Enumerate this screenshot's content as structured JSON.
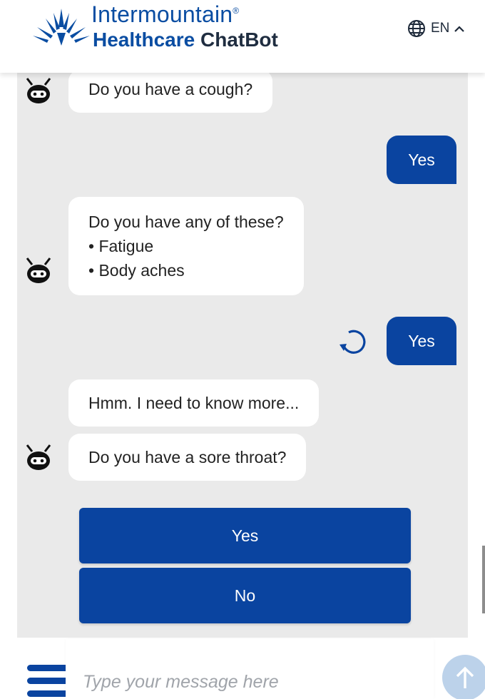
{
  "header": {
    "brand_line1": "Intermountain",
    "brand_reg": "®",
    "brand_healthcare": "Healthcare",
    "brand_chatbot": "ChatBot",
    "language": "EN",
    "accent_color": "#0a4da2"
  },
  "messages": [
    {
      "from": "bot",
      "lines": [
        "Do you have a cough?"
      ]
    },
    {
      "from": "user",
      "text": "Yes"
    },
    {
      "from": "bot",
      "lines": [
        "Do you have any of these?",
        "• Fatigue",
        "• Body aches"
      ]
    },
    {
      "from": "user",
      "text": "Yes"
    },
    {
      "from": "bot",
      "lines": [
        "Hmm. I need to know more..."
      ]
    },
    {
      "from": "bot",
      "lines": [
        "Do you have a sore throat?"
      ]
    }
  ],
  "quick_replies": [
    "Yes",
    "No"
  ],
  "composer": {
    "placeholder": "Type your message here"
  },
  "icons": {
    "logo": "intermountain-star-logo",
    "language": "globe-icon",
    "language_toggle": "chevron-up-icon",
    "avatar": "robot-avatar-icon",
    "retry": "retry-icon",
    "menu": "hamburger-menu-icon",
    "send": "arrow-up-send-icon"
  },
  "colors": {
    "primary": "#0a44a0",
    "chat_background": "#eaeaea",
    "send_button": "#bcd2ea"
  }
}
